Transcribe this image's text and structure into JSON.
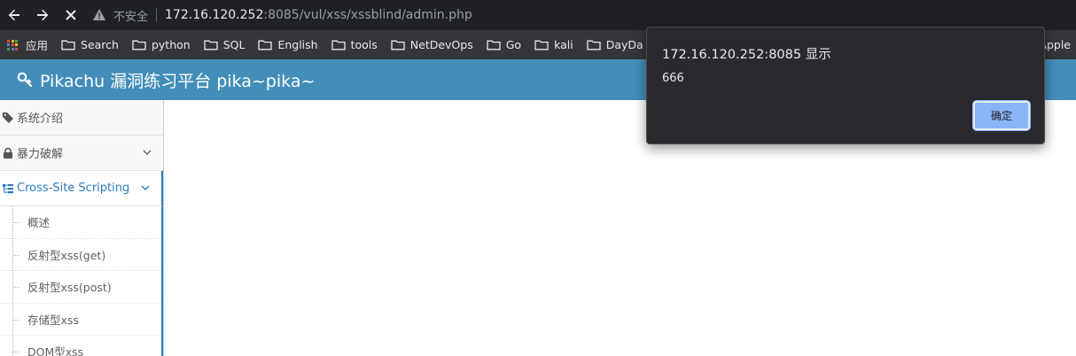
{
  "browser": {
    "insecure_label": "不安全",
    "url_host": "172.16.120.252",
    "url_rest": ":8085/vul/xss/xssblind/admin.php"
  },
  "bookmarks": {
    "apps_label": "应用",
    "items": [
      "Search",
      "python",
      "SQL",
      "English",
      "tools",
      "NetDevOps",
      "Go",
      "kali",
      "DayDa"
    ],
    "apple_label": "Apple"
  },
  "header": {
    "title": "Pikachu 漏洞练习平台 pika~pika~"
  },
  "sidebar": {
    "items": [
      {
        "label": "系统介绍",
        "icon": "tags-icon"
      },
      {
        "label": "暴力破解",
        "icon": "lock-icon"
      },
      {
        "label": "Cross-Site Scripting",
        "icon": "sitemap-icon"
      }
    ],
    "subitems": [
      "概述",
      "反射型xss(get)",
      "反射型xss(post)",
      "存储型xss",
      "DOM型xss"
    ]
  },
  "dialog": {
    "title": "172.16.120.252:8085 显示",
    "message": "666",
    "ok_label": "确定"
  },
  "colors": {
    "header_bg": "#438eb9",
    "active_blue": "#2b7dbc",
    "dialog_bg": "#292a2d",
    "ok_button": "#8ab4f8"
  }
}
